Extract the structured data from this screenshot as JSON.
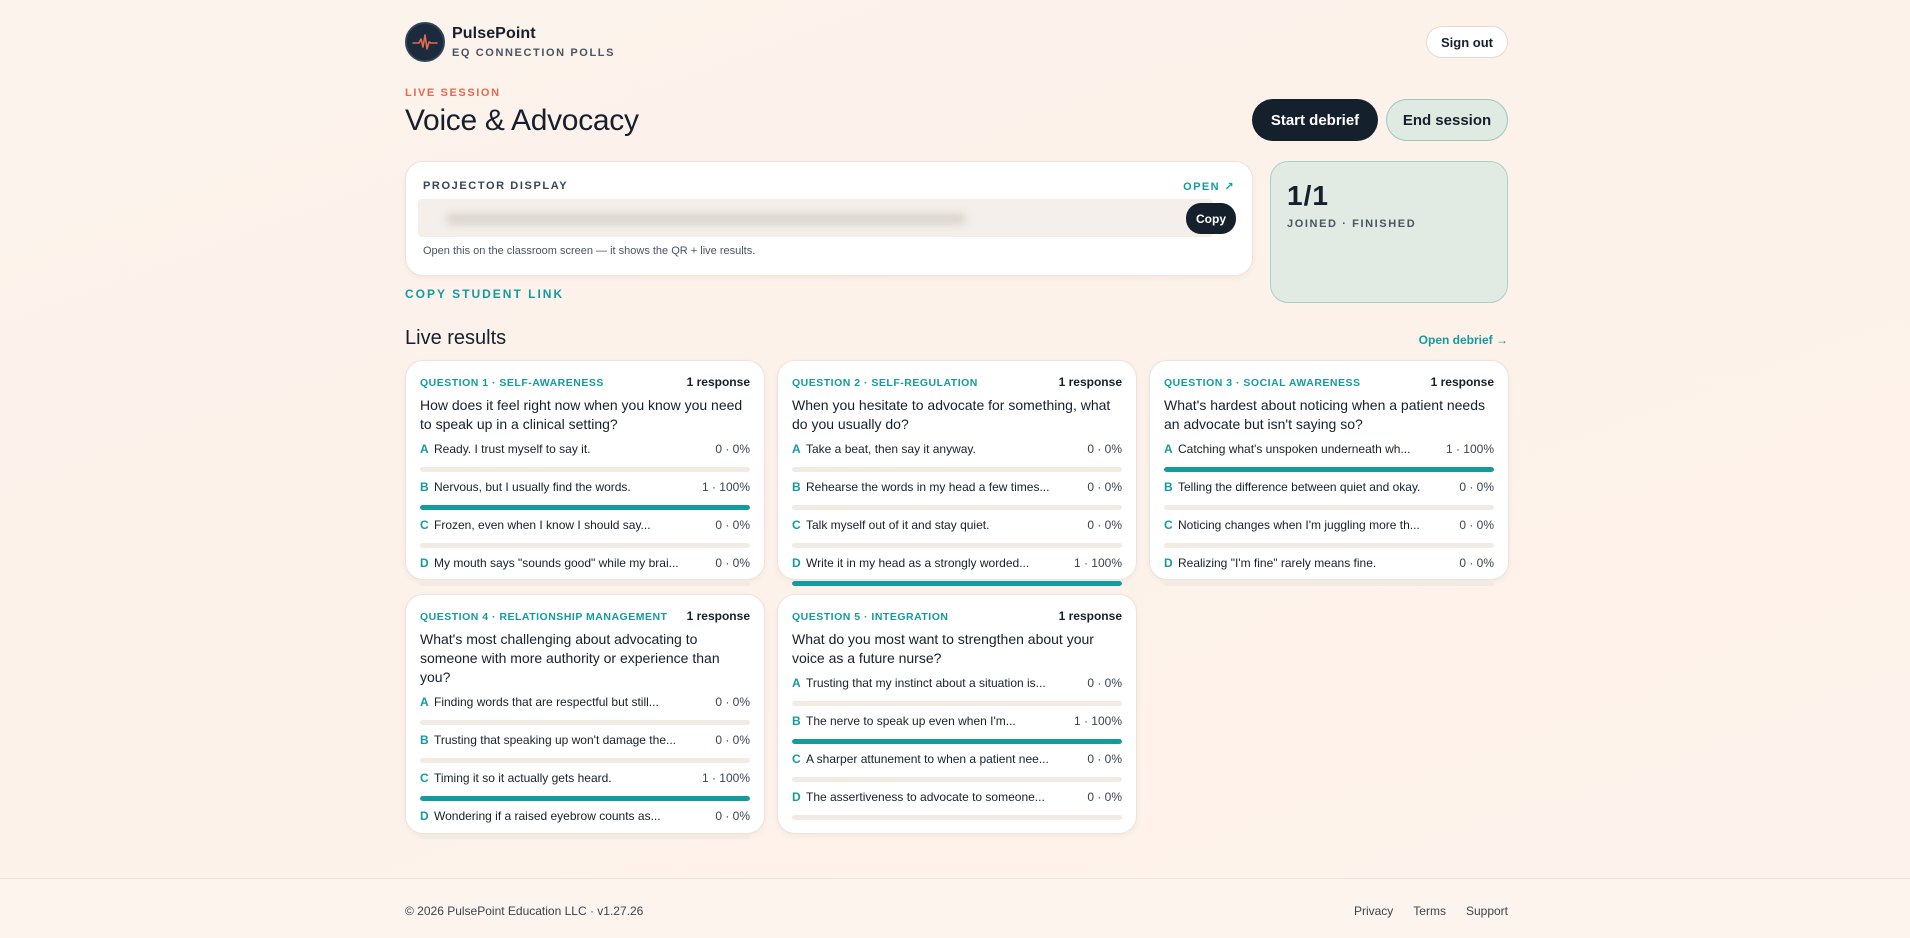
{
  "brand": {
    "name": "PulsePoint",
    "subtitle": "EQ CONNECTION POLLS"
  },
  "header": {
    "signout_label": "Sign out"
  },
  "session": {
    "live_label": "LIVE SESSION",
    "title": "Voice & Advocacy",
    "start_debrief_label": "Start debrief",
    "end_session_label": "End session"
  },
  "projector": {
    "label": "PROJECTOR DISPLAY",
    "open_label": "OPEN ↗",
    "copy_label": "Copy",
    "help_text": "Open this on the classroom screen — it shows the QR + live results."
  },
  "copy_student_link_label": "COPY STUDENT LINK",
  "stats": {
    "value": "1/1",
    "label": "JOINED · FINISHED"
  },
  "results": {
    "title": "Live results",
    "open_debrief_label": "Open debrief →",
    "questions": [
      {
        "tag": "QUESTION 1 · SELF-AWARENESS",
        "responses": "1 response",
        "text": "How does it feel right now when you know you need to speak up in a clinical setting?",
        "options": [
          {
            "letter": "A",
            "text": "Ready. I trust myself to say it.",
            "count": "0 · 0%",
            "fraction": 0
          },
          {
            "letter": "B",
            "text": "Nervous, but I usually find the words.",
            "count": "1 · 100%",
            "fraction": 1
          },
          {
            "letter": "C",
            "text": "Frozen, even when I know I should say...",
            "count": "0 · 0%",
            "fraction": 0
          },
          {
            "letter": "D",
            "text": "My mouth says \"sounds good\" while my brai...",
            "count": "0 · 0%",
            "fraction": 0
          }
        ]
      },
      {
        "tag": "QUESTION 2 · SELF-REGULATION",
        "responses": "1 response",
        "text": "When you hesitate to advocate for something, what do you usually do?",
        "options": [
          {
            "letter": "A",
            "text": "Take a beat, then say it anyway.",
            "count": "0 · 0%",
            "fraction": 0
          },
          {
            "letter": "B",
            "text": "Rehearse the words in my head a few times...",
            "count": "0 · 0%",
            "fraction": 0
          },
          {
            "letter": "C",
            "text": "Talk myself out of it and stay quiet.",
            "count": "0 · 0%",
            "fraction": 0
          },
          {
            "letter": "D",
            "text": "Write it in my head as a strongly worded...",
            "count": "1 · 100%",
            "fraction": 1
          }
        ]
      },
      {
        "tag": "QUESTION 3 · SOCIAL AWARENESS",
        "responses": "1 response",
        "text": "What's hardest about noticing when a patient needs an advocate but isn't saying so?",
        "options": [
          {
            "letter": "A",
            "text": "Catching what's unspoken underneath wh...",
            "count": "1 · 100%",
            "fraction": 1
          },
          {
            "letter": "B",
            "text": "Telling the difference between quiet and okay.",
            "count": "0 · 0%",
            "fraction": 0
          },
          {
            "letter": "C",
            "text": "Noticing changes when I'm juggling more th...",
            "count": "0 · 0%",
            "fraction": 0
          },
          {
            "letter": "D",
            "text": "Realizing \"I'm fine\" rarely means fine.",
            "count": "0 · 0%",
            "fraction": 0
          }
        ]
      },
      {
        "tag": "QUESTION 4 · RELATIONSHIP MANAGEMENT",
        "responses": "1 response",
        "text": "What's most challenging about advocating to someone with more authority or experience than you?",
        "options": [
          {
            "letter": "A",
            "text": "Finding words that are respectful but still...",
            "count": "0 · 0%",
            "fraction": 0
          },
          {
            "letter": "B",
            "text": "Trusting that speaking up won't damage the...",
            "count": "0 · 0%",
            "fraction": 0
          },
          {
            "letter": "C",
            "text": "Timing it so it actually gets heard.",
            "count": "1 · 100%",
            "fraction": 1
          },
          {
            "letter": "D",
            "text": "Wondering if a raised eyebrow counts as...",
            "count": "0 · 0%",
            "fraction": 0
          }
        ]
      },
      {
        "tag": "QUESTION 5 · INTEGRATION",
        "responses": "1 response",
        "text": "What do you most want to strengthen about your voice as a future nurse?",
        "options": [
          {
            "letter": "A",
            "text": "Trusting that my instinct about a situation is...",
            "count": "0 · 0%",
            "fraction": 0
          },
          {
            "letter": "B",
            "text": "The nerve to speak up even when I'm...",
            "count": "1 · 100%",
            "fraction": 1
          },
          {
            "letter": "C",
            "text": "A sharper attunement to when a patient nee...",
            "count": "0 · 0%",
            "fraction": 0
          },
          {
            "letter": "D",
            "text": "The assertiveness to advocate to someone...",
            "count": "0 · 0%",
            "fraction": 0
          }
        ]
      }
    ]
  },
  "footer": {
    "copyright": "© 2026 PulsePoint Education LLC  ·  v1.27.26",
    "links": [
      "Privacy",
      "Terms",
      "Support"
    ]
  },
  "colors": {
    "accent": "#139ba0",
    "dark": "#15202d",
    "live": "#e36b52",
    "bar_track": "#f2ebe3"
  }
}
